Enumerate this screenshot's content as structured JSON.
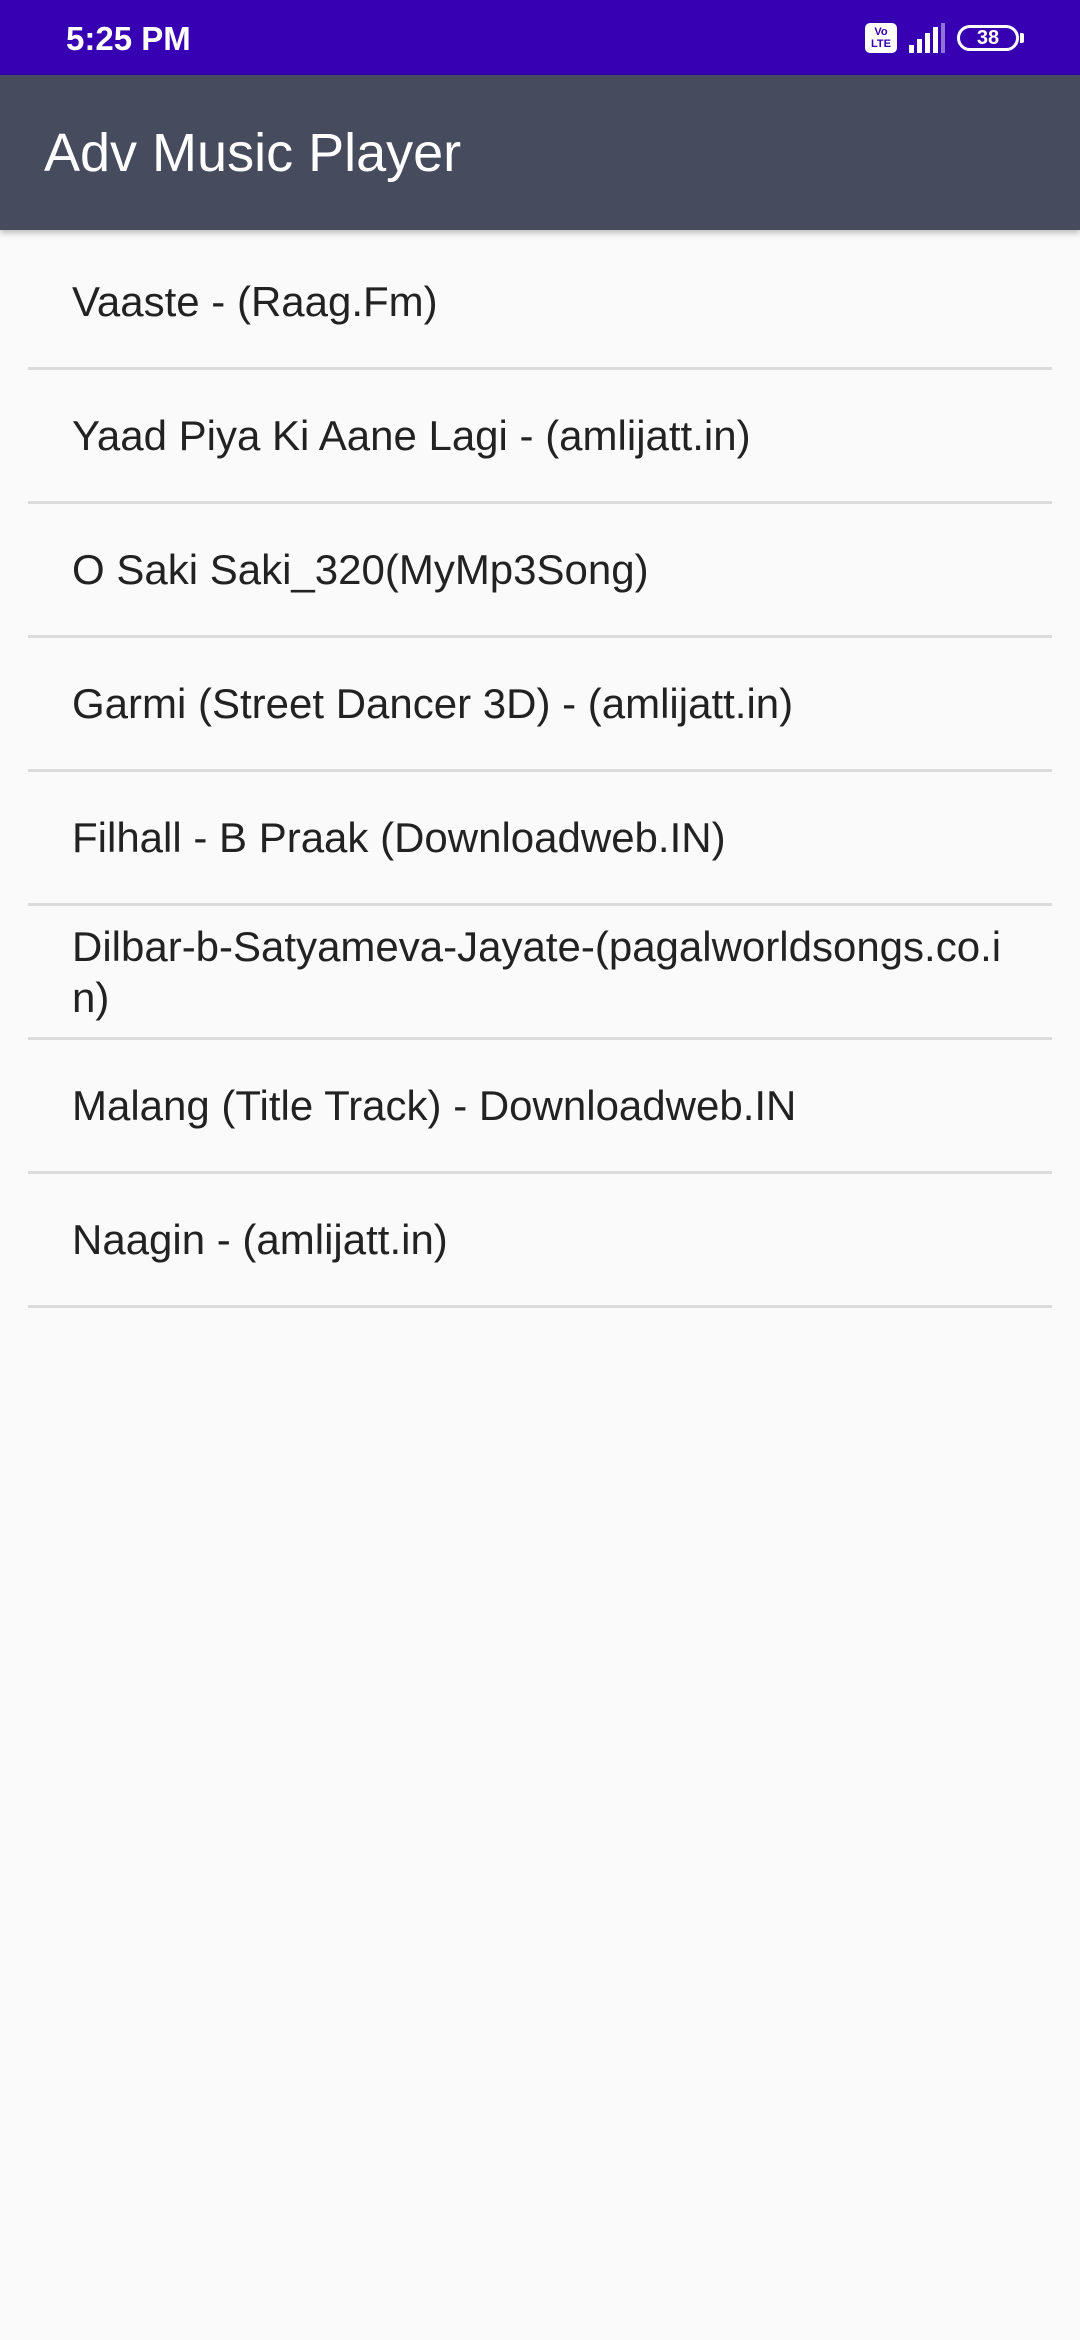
{
  "status_bar": {
    "time": "5:25 PM",
    "volte_line1": "Vo",
    "volte_line2": "LTE",
    "battery": "38"
  },
  "app_bar": {
    "title": "Adv Music Player"
  },
  "songs": [
    {
      "title": "Vaaste - (Raag.Fm)"
    },
    {
      "title": "Yaad Piya Ki Aane Lagi - (amlijatt.in)"
    },
    {
      "title": "O Saki Saki_320(MyMp3Song)"
    },
    {
      "title": "Garmi (Street Dancer 3D) - (amlijatt.in)"
    },
    {
      "title": "Filhall - B Praak (Downloadweb.IN)"
    },
    {
      "title": "Dilbar-b-Satyameva-Jayate-(pagalworldsongs.co.in)"
    },
    {
      "title": "Malang (Title Track) - Downloadweb.IN"
    },
    {
      "title": "Naagin - (amlijatt.in)"
    }
  ]
}
